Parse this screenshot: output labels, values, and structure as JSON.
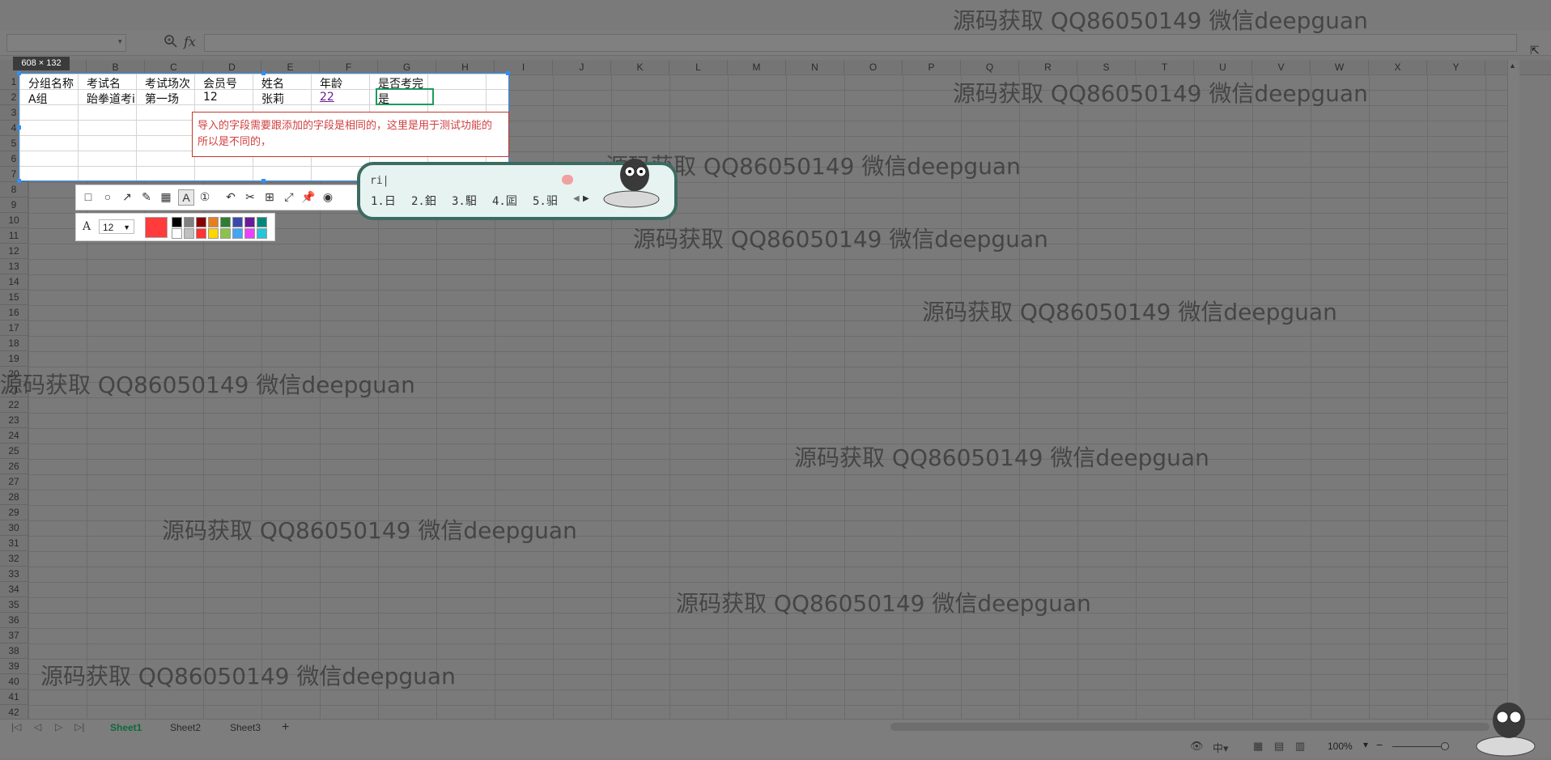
{
  "formula_bar": {
    "fx": "fx"
  },
  "columns": [
    "A",
    "B",
    "C",
    "D",
    "E",
    "F",
    "G",
    "H",
    "I",
    "J",
    "K",
    "L",
    "M",
    "N",
    "O",
    "P",
    "Q",
    "R",
    "S",
    "T",
    "U",
    "V",
    "W",
    "X",
    "Y"
  ],
  "rows": [
    "1",
    "2",
    "3",
    "4",
    "5",
    "6",
    "7",
    "8",
    "9",
    "10",
    "11",
    "12",
    "13",
    "14",
    "15",
    "16",
    "17",
    "18",
    "19",
    "20",
    "21",
    "22",
    "23",
    "24",
    "25",
    "26",
    "27",
    "28",
    "29",
    "30",
    "31",
    "32",
    "33",
    "34",
    "35",
    "36",
    "37",
    "38",
    "39",
    "40",
    "41",
    "42"
  ],
  "selection": {
    "size_label": "608 × 132"
  },
  "table": {
    "headers": [
      "分组名称",
      "考试名",
      "考试场次",
      "会员号",
      "姓名",
      "年龄",
      "是否考完"
    ],
    "row2": [
      "A组",
      "跆拳道考i",
      "第一场",
      "12",
      "张莉",
      "22",
      "是"
    ]
  },
  "comment": {
    "text": "导入的字段需要跟添加的字段是相同的，这里是用于测试功能的所以是不同的，"
  },
  "toolbar": {
    "font_size": "12",
    "current_color": "#ff3b3b",
    "swatches": [
      "#000000",
      "#808080",
      "#8b0000",
      "#e67e22",
      "#2e7d32",
      "#3949ab",
      "#6a1b9a",
      "#00897b",
      "#ffffff",
      "#c0c0c0",
      "#ff3333",
      "#ffd600",
      "#8bc34a",
      "#42a5f5",
      "#ec40ff",
      "#26c6da"
    ]
  },
  "ime": {
    "input": "ri|",
    "candidates": [
      "1.日",
      "2.鈤",
      "3.馹",
      "4.囸",
      "5.驲"
    ]
  },
  "sheets": [
    "Sheet1",
    "Sheet2",
    "Sheet3"
  ],
  "status": {
    "zoom": "100%"
  },
  "watermark": "源码获取 QQ86050149 微信deepguan"
}
